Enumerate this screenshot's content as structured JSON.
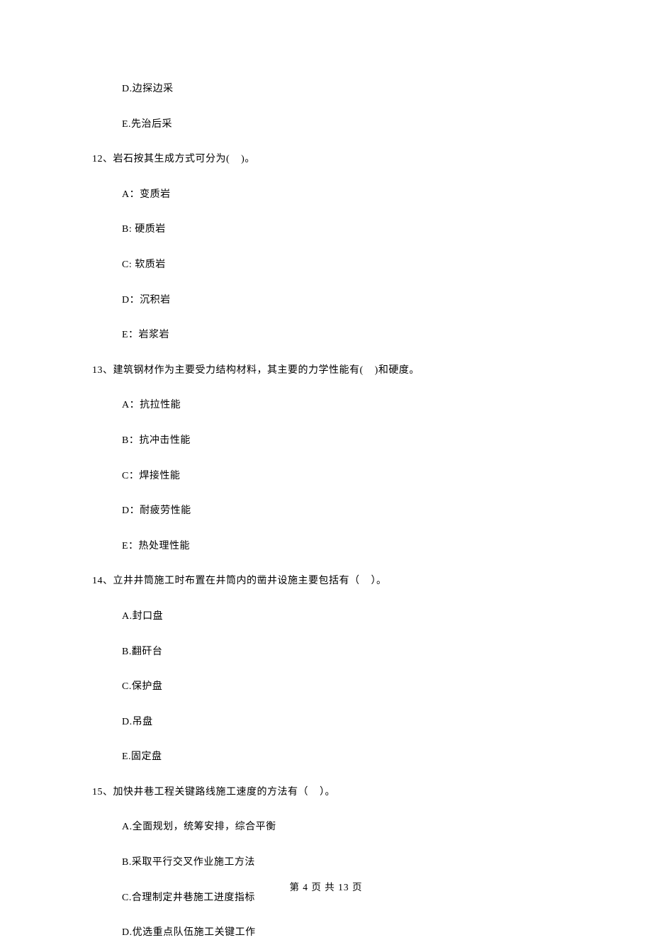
{
  "prev_options": {
    "d": "D.边探边采",
    "e": "E.先治后采"
  },
  "q12": {
    "stem": "12、岩石按其生成方式可分为(    )。",
    "a": "A：变质岩",
    "b": "B: 硬质岩",
    "c": "C: 软质岩",
    "d": "D：沉积岩",
    "e": "E：岩浆岩"
  },
  "q13": {
    "stem": "13、建筑钢材作为主要受力结构材料，其主要的力学性能有(    )和硬度。",
    "a": "A：抗拉性能",
    "b": "B：抗冲击性能",
    "c": "C：焊接性能",
    "d": "D：耐疲劳性能",
    "e": "E：热处理性能"
  },
  "q14": {
    "stem": "14、立井井筒施工时布置在井筒内的凿井设施主要包括有（    ）。",
    "a": "A.封口盘",
    "b": "B.翻矸台",
    "c": "C.保护盘",
    "d": "D.吊盘",
    "e": "E.固定盘"
  },
  "q15": {
    "stem": "15、加快井巷工程关键路线施工速度的方法有（    ）。",
    "a": "A.全面规划，统筹安排，综合平衡",
    "b": "B.采取平行交叉作业施工方法",
    "c": "C.合理制定井巷施工进度指标",
    "d": "D.优选重点队伍施工关键工作"
  },
  "footer": "第 4 页 共 13 页"
}
